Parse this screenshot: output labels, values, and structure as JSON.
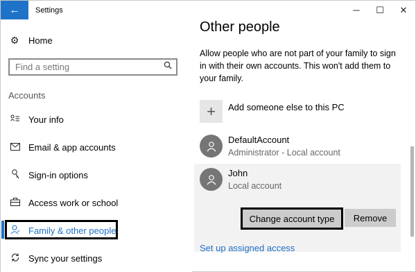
{
  "titlebar": {
    "back_icon": "←",
    "title": "Settings",
    "minimize": "─",
    "maximize": "☐",
    "close": "✕"
  },
  "nav": {
    "home": {
      "icon": "gear-icon",
      "label": "Home"
    },
    "search": {
      "placeholder": "Find a setting"
    },
    "section": "Accounts",
    "items": [
      {
        "label": "Your info",
        "icon": "person-card-icon"
      },
      {
        "label": "Email & app accounts",
        "icon": "mail-icon"
      },
      {
        "label": "Sign-in options",
        "icon": "key-icon"
      },
      {
        "label": "Access work or school",
        "icon": "briefcase-icon"
      },
      {
        "label": "Family & other people",
        "icon": "person-icon",
        "active": true
      },
      {
        "label": "Sync your settings",
        "icon": "sync-icon"
      }
    ]
  },
  "content": {
    "title": "Other people",
    "description": "Allow people who are not part of your family to sign in with their own accounts. This won't add them to your family.",
    "add_label": "Add someone else to this PC",
    "accounts": [
      {
        "name": "DefaultAccount",
        "sub": "Administrator - Local account"
      },
      {
        "name": "John",
        "sub": "Local account"
      }
    ],
    "change_button": "Change account type",
    "remove_button": "Remove",
    "link": "Set up assigned access"
  },
  "colors": {
    "accent": "#1e73c9",
    "link": "#1e6fc5",
    "panel": "#f2f2f2",
    "button": "#cccccc",
    "avatar": "#767676"
  }
}
